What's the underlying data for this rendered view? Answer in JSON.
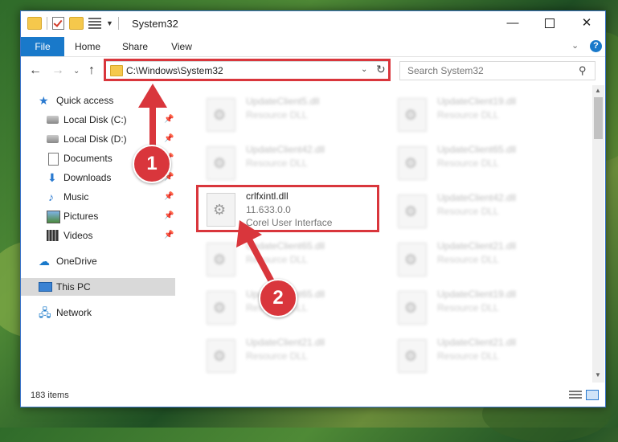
{
  "window": {
    "title": "System32",
    "controls": {
      "minimize": "—",
      "close": "✕"
    }
  },
  "ribbon": {
    "tabs": [
      "File",
      "Home",
      "Share",
      "View"
    ]
  },
  "address": {
    "path": "C:\\Windows\\System32",
    "search_placeholder": "Search System32"
  },
  "sidebar": {
    "quick_access": "Quick access",
    "items": [
      {
        "label": "Local Disk (C:)",
        "icon": "drive-icon",
        "pinned": true
      },
      {
        "label": "Local Disk (D:)",
        "icon": "drive-icon",
        "pinned": true
      },
      {
        "label": "Documents",
        "icon": "documents-icon",
        "pinned": true
      },
      {
        "label": "Downloads",
        "icon": "downloads-icon",
        "pinned": true
      },
      {
        "label": "Music",
        "icon": "music-icon",
        "pinned": true
      },
      {
        "label": "Pictures",
        "icon": "pictures-icon",
        "pinned": true
      },
      {
        "label": "Videos",
        "icon": "videos-icon",
        "pinned": true
      }
    ],
    "onedrive": "OneDrive",
    "this_pc": "This PC",
    "network": "Network"
  },
  "files": {
    "highlighted": {
      "name": "crlfxintl.dll",
      "version": "11.633.0.0",
      "description": "Corel User Interface"
    },
    "left": [
      {
        "name": "UpdateClient5.dll",
        "type": "Resource DLL"
      },
      {
        "name": "UpdateClient42.dll",
        "type": "Resource DLL"
      },
      {
        "name": "UpdateClient65.dll",
        "type": "Resource DLL"
      },
      {
        "name": "UpdateClient65.dll",
        "type": "Resource DLL"
      },
      {
        "name": "UpdateClient21.dll",
        "type": "Resource DLL"
      }
    ],
    "right": [
      {
        "name": "UpdateClient19.dll",
        "type": "Resource DLL"
      },
      {
        "name": "UpdateClient65.dll",
        "type": "Resource DLL"
      },
      {
        "name": "UpdateClient42.dll",
        "type": "Resource DLL"
      },
      {
        "name": "UpdateClient21.dll",
        "type": "Resource DLL"
      },
      {
        "name": "UpdateClient19.dll",
        "type": "Resource DLL"
      },
      {
        "name": "UpdateClient21.dll",
        "type": "Resource DLL"
      }
    ]
  },
  "status": {
    "item_count": "183 items"
  },
  "annotations": {
    "step1": "1",
    "step2": "2",
    "color": "#d9363c"
  }
}
